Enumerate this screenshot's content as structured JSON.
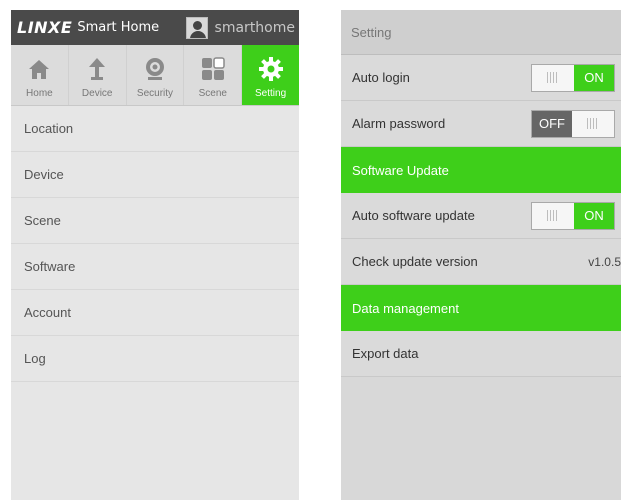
{
  "left": {
    "header": {
      "logo_text": "LINXE",
      "logo_subtext": "Smart Home",
      "username": "smarthome"
    },
    "tabs": [
      {
        "label": "Home",
        "icon": "house-icon"
      },
      {
        "label": "Device",
        "icon": "lamp-icon"
      },
      {
        "label": "Security",
        "icon": "camera-icon"
      },
      {
        "label": "Scene",
        "icon": "grid-icon"
      },
      {
        "label": "Setting",
        "icon": "gear-icon",
        "active": true
      }
    ],
    "menu": [
      {
        "label": "Location"
      },
      {
        "label": "Device"
      },
      {
        "label": "Scene"
      },
      {
        "label": "Software"
      },
      {
        "label": "Account"
      },
      {
        "label": "Log"
      }
    ]
  },
  "right": {
    "title": "Setting",
    "auto_login": {
      "label": "Auto login",
      "state": "ON"
    },
    "alarm_password": {
      "label": "Alarm password",
      "state": "OFF"
    },
    "software_update_header": "Software Update",
    "auto_software_update": {
      "label": "Auto software update",
      "state": "ON"
    },
    "check_update": {
      "label": "Check update version",
      "version": "v1.0.5"
    },
    "data_management_header": "Data management",
    "export_data": {
      "label": "Export data"
    }
  },
  "colors": {
    "accent_green": "#3ecf1a",
    "header_dark": "#4a4a4a",
    "toggle_off": "#666666"
  }
}
